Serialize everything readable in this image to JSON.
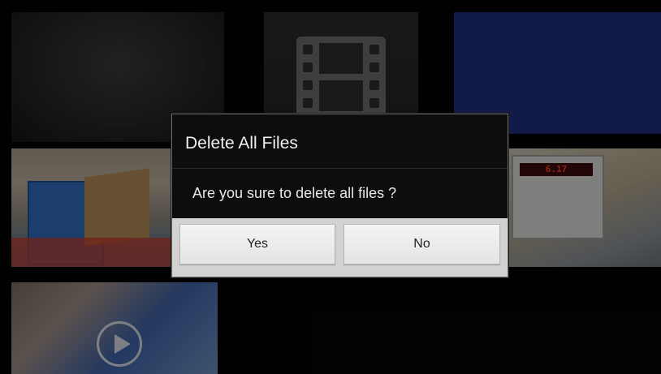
{
  "dialog": {
    "title": "Delete All Files",
    "message": "Are you sure to delete all files ?",
    "yes_label": "Yes",
    "no_label": "No"
  },
  "thumbnails": [
    {
      "kind": "dark-image"
    },
    {
      "kind": "video-placeholder",
      "icon": "film-strip-icon"
    },
    {
      "kind": "blue-image"
    },
    {
      "kind": "warehouse-photo"
    },
    {
      "kind": "meter-photo",
      "display_text": "6.17"
    },
    {
      "kind": "video",
      "icon": "play-icon"
    }
  ],
  "colors": {
    "dialog_bg": "#0d0d0d",
    "button_bar": "#d2d2d2",
    "button_text": "#222222",
    "title_text": "#f0f0f0",
    "tile_blue": "#1f2f7d"
  }
}
